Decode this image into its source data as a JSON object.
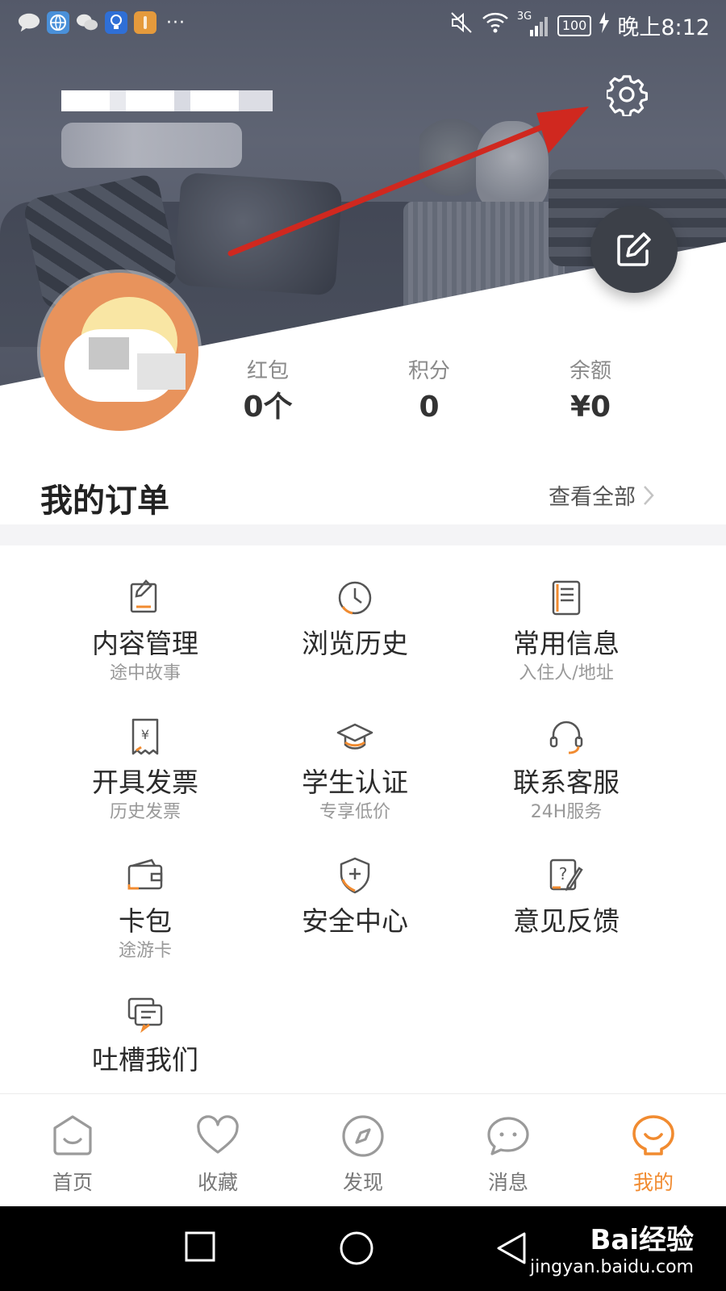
{
  "status_bar": {
    "network": "3G",
    "battery": "100",
    "time": "晚上8:12"
  },
  "stats": [
    {
      "label": "红包",
      "value": "0个"
    },
    {
      "label": "积分",
      "value": "0"
    },
    {
      "label": "余额",
      "value": "¥0"
    }
  ],
  "orders": {
    "title": "我的订单",
    "view_all": "查看全部"
  },
  "services": [
    {
      "title": "内容管理",
      "subtitle": "途中故事",
      "icon": "edit-doc-icon"
    },
    {
      "title": "浏览历史",
      "subtitle": "",
      "icon": "clock-icon"
    },
    {
      "title": "常用信息",
      "subtitle": "入住人/地址",
      "icon": "info-doc-icon"
    },
    {
      "title": "开具发票",
      "subtitle": "历史发票",
      "icon": "invoice-icon"
    },
    {
      "title": "学生认证",
      "subtitle": "专享低价",
      "icon": "graduation-cap-icon"
    },
    {
      "title": "联系客服",
      "subtitle": "24H服务",
      "icon": "headset-icon"
    },
    {
      "title": "卡包",
      "subtitle": "途游卡",
      "icon": "wallet-icon"
    },
    {
      "title": "安全中心",
      "subtitle": "",
      "icon": "shield-icon"
    },
    {
      "title": "意见反馈",
      "subtitle": "",
      "icon": "feedback-icon"
    },
    {
      "title": "吐槽我们",
      "subtitle": "",
      "icon": "chat-icon"
    }
  ],
  "tabs": [
    {
      "label": "首页",
      "icon": "home-icon",
      "active": false
    },
    {
      "label": "收藏",
      "icon": "heart-icon",
      "active": false
    },
    {
      "label": "发现",
      "icon": "compass-icon",
      "active": false
    },
    {
      "label": "消息",
      "icon": "message-icon",
      "active": false
    },
    {
      "label": "我的",
      "icon": "profile-icon",
      "active": true
    }
  ],
  "watermark": {
    "main": "Bai经验",
    "sub": "jingyan.baidu.com"
  },
  "colors": {
    "accent": "#f18b30",
    "annotation_arrow": "#d0281f",
    "fab": "#3c4048"
  }
}
